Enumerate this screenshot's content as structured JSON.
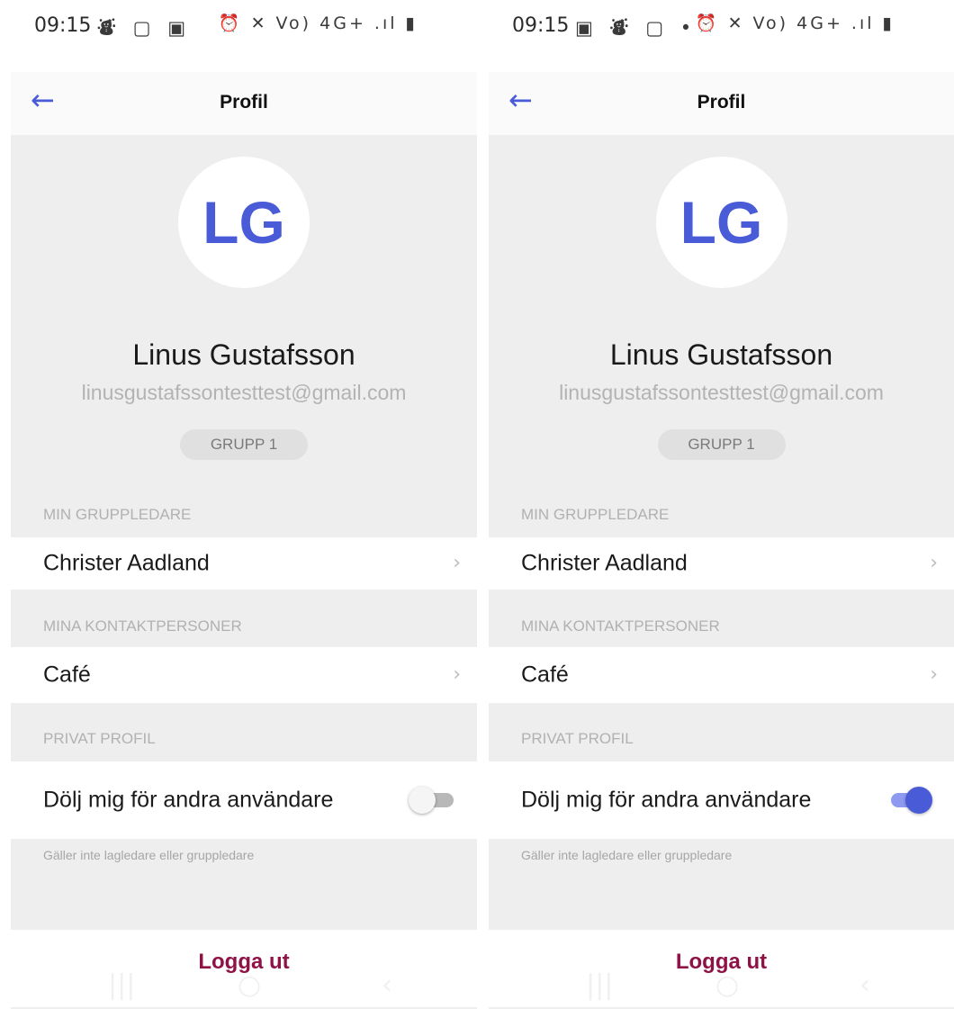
{
  "screens": [
    {
      "status": {
        "time": "09:15",
        "left_icons": "⛇ ▢ ▣",
        "right_icons": "⏰ ✕ Vo) 4G+ .ıl ▮"
      },
      "title": "Profil",
      "avatar_initials": "LG",
      "name": "Linus Gustafsson",
      "email": "linusgustafssontesttest@gmail.com",
      "group": "GRUPP 1",
      "sections": {
        "leader_header": "MIN GRUPPLEDARE",
        "leader": "Christer Aadland",
        "contacts_header": "MINA KONTAKTPERSONER",
        "contact": "Café",
        "privacy_header": "PRIVAT PROFIL",
        "hide_label": "Dölj mig för andra användare",
        "hide_enabled": false,
        "note": "Gäller inte lagledare eller gruppledare"
      },
      "logout": "Logga ut"
    },
    {
      "status": {
        "time": "09:15",
        "left_icons": "▣ ⛇ ▢ •",
        "right_icons": "⏰ ✕ Vo) 4G+ .ıl ▮"
      },
      "title": "Profil",
      "avatar_initials": "LG",
      "name": "Linus Gustafsson",
      "email": "linusgustafssontesttest@gmail.com",
      "group": "GRUPP 1",
      "sections": {
        "leader_header": "MIN GRUPPLEDARE",
        "leader": "Christer Aadland",
        "contacts_header": "MINA KONTAKTPERSONER",
        "contact": "Café",
        "privacy_header": "PRIVAT PROFIL",
        "hide_label": "Dölj mig för andra användare",
        "hide_enabled": true,
        "note": "Gäller inte lagledare eller gruppledare"
      },
      "logout": "Logga ut"
    }
  ],
  "colors": {
    "accent": "#4a5bd8",
    "logout": "#8e1246",
    "background": "#eeeeee"
  },
  "icons": {
    "back": "arrow-left-icon",
    "chevron": "chevron-right-icon"
  }
}
